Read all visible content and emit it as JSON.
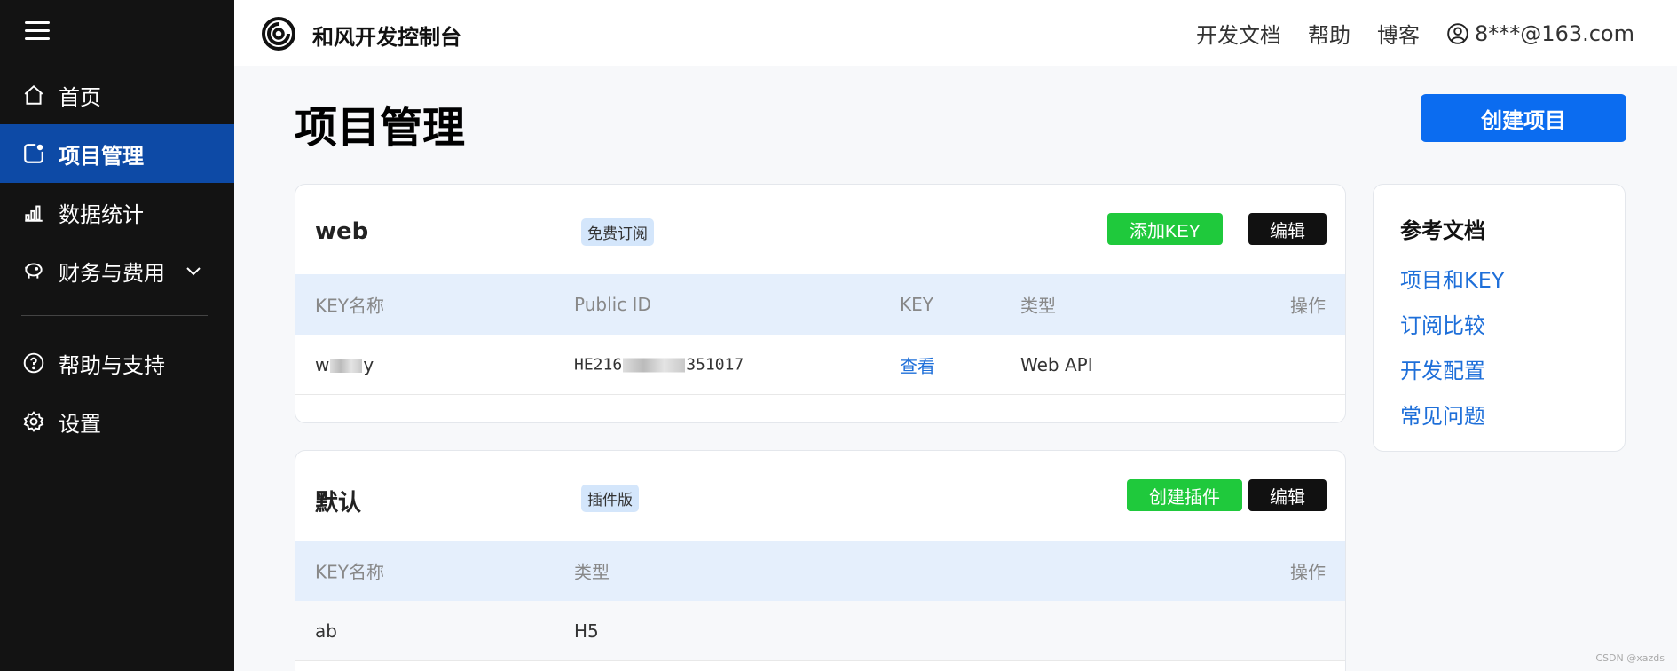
{
  "sidebar": {
    "items": [
      {
        "label": "首页",
        "icon": "home-icon"
      },
      {
        "label": "项目管理",
        "icon": "project-icon",
        "active": true
      },
      {
        "label": "数据统计",
        "icon": "bar-chart-icon"
      },
      {
        "label": "财务与费用",
        "icon": "piggy-bank-icon"
      },
      {
        "label": "帮助与支持",
        "icon": "help-icon"
      },
      {
        "label": "设置",
        "icon": "gear-icon"
      }
    ]
  },
  "header": {
    "brand": "和风开发控制台",
    "nav": [
      "开发文档",
      "帮助",
      "博客"
    ],
    "user": "8***@163.com"
  },
  "main": {
    "title": "项目管理",
    "create_label": "创建项目"
  },
  "projects": [
    {
      "name": "web",
      "tag": "免费订阅",
      "primary_label": "添加KEY",
      "edit_label": "编辑",
      "columns": [
        "KEY名称",
        "Public ID",
        "KEY",
        "类型",
        "操作"
      ],
      "rows": [
        {
          "key_prefix": "w",
          "key_suffix": "y",
          "public_id_prefix": "HE216",
          "public_id_suffix": "351017",
          "key": "查看",
          "type": "Web API"
        }
      ]
    },
    {
      "name": "默认",
      "tag": "插件版",
      "primary_label": "创建插件",
      "edit_label": "编辑",
      "columns": [
        "KEY名称",
        "类型",
        "操作"
      ],
      "rows": [
        {
          "key_name": "ab",
          "type": "H5"
        }
      ]
    }
  ],
  "reference": {
    "title": "参考文档",
    "links": [
      "项目和KEY",
      "订阅比较",
      "开发配置",
      "常见问题"
    ]
  },
  "watermark": "CSDN @xazds",
  "colors": {
    "sidebar_bg": "#131313",
    "active_nav": "#0d4aa6",
    "primary_blue": "#0b6cf0",
    "green": "#1fc93c",
    "link_blue": "#1e6fd9",
    "table_header": "#e5effc",
    "stats_orange": "#f0a020"
  }
}
